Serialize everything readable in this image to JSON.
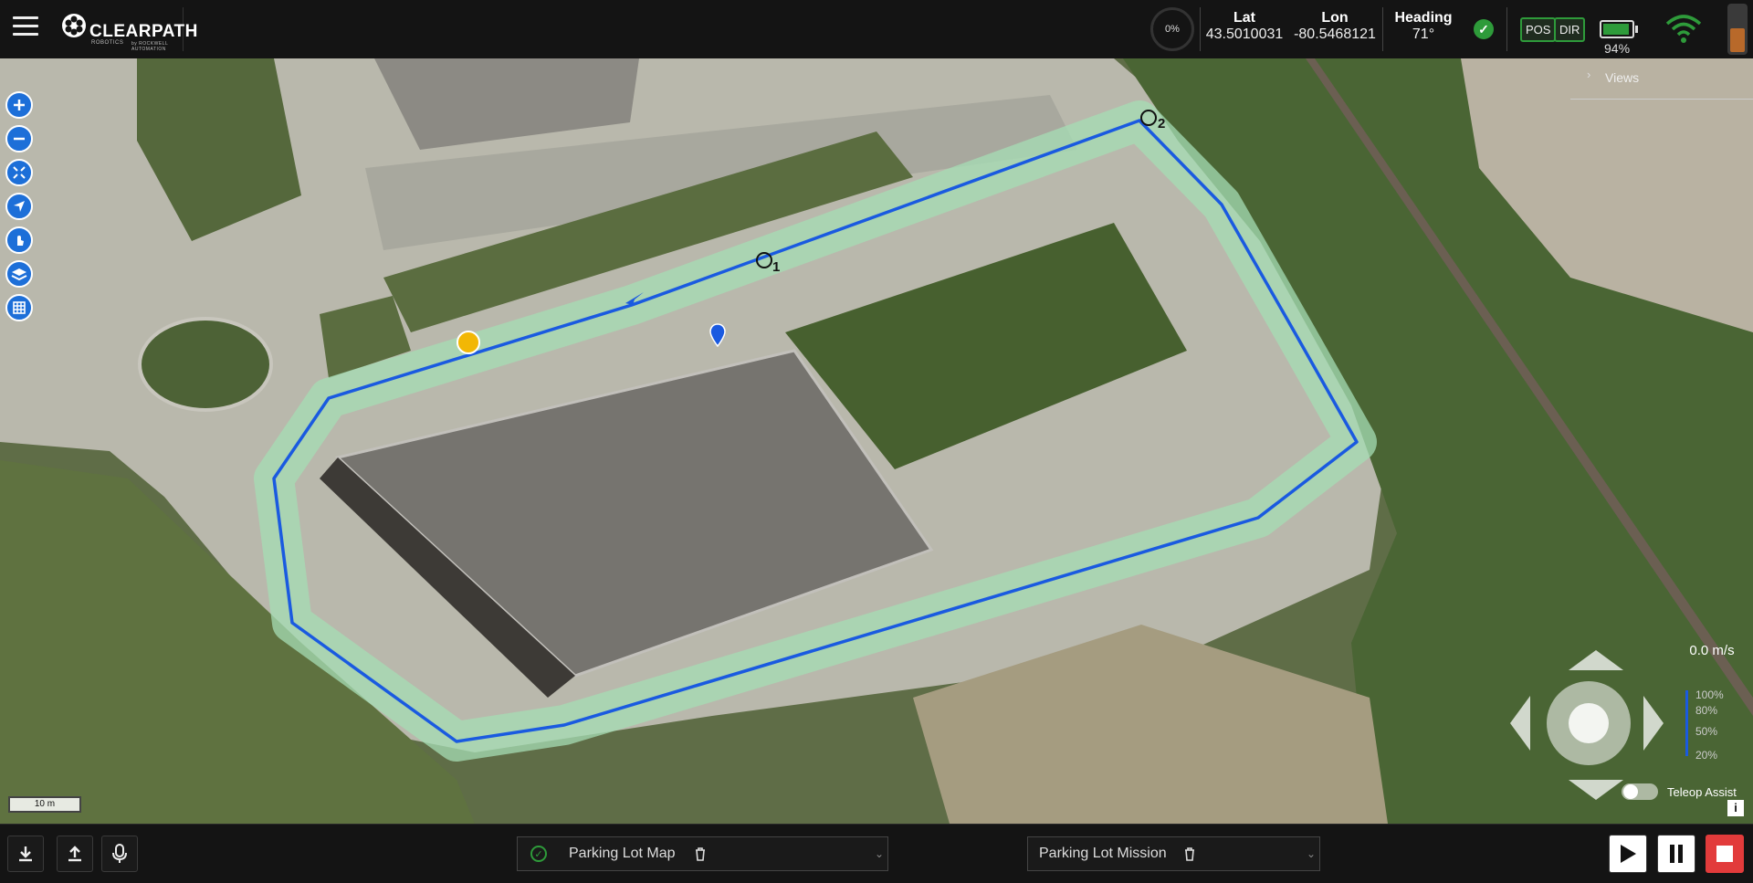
{
  "app": {
    "brand_name": "CLEARPATH",
    "brand_sub": "ROBOTICS",
    "brand_sub2": "by ROCKWELL AUTOMATION"
  },
  "status": {
    "progress": "0%",
    "lat_label": "Lat",
    "lat_value": "43.5010031",
    "lon_label": "Lon",
    "lon_value": "-80.5468121",
    "heading_label": "Heading",
    "heading_value": "71°",
    "pos_label": "POS",
    "dir_label": "DIR",
    "battery_value": "94%",
    "battery_level": 0.94,
    "colors": {
      "ok": "#2e9b3a",
      "route": "#1a5ae0",
      "stop": "#e23b3b"
    }
  },
  "map": {
    "views_label": "Views",
    "scale_label": "10 m",
    "waypoint_1": "1",
    "waypoint_2": "2",
    "speed": "0.0 m/s",
    "speed_levels": [
      "100%",
      "80%",
      "50%",
      "20%"
    ],
    "teleop_label": "Teleop Assist",
    "teleop_enabled": false,
    "tools": [
      "zoom-in-icon",
      "zoom-out-icon",
      "fit-icon",
      "locate-icon",
      "pan-icon",
      "layers-icon",
      "grid-icon"
    ]
  },
  "bottom": {
    "map_select": "Parking Lot Map",
    "mission_select": "Parking Lot Mission"
  }
}
